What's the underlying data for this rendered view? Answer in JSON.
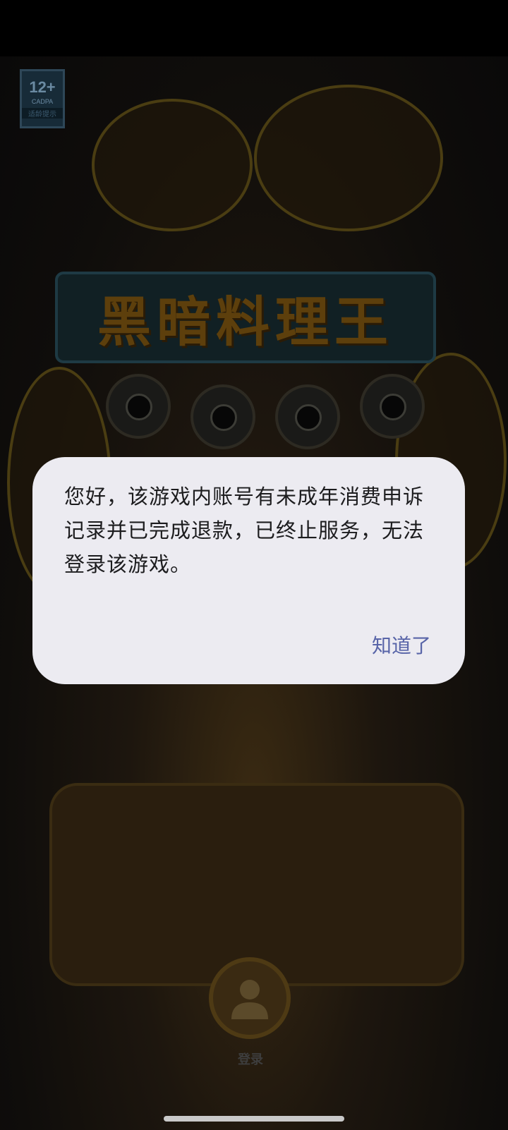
{
  "age_rating": {
    "number": "12+",
    "agency": "CADPA",
    "tip": "适龄提示"
  },
  "game": {
    "title": "黑暗料理王"
  },
  "dialog": {
    "message": "您好，该游戏内账号有未成年消费申诉记录并已完成退款，已终止服务，无法登录该游戏。",
    "confirm_label": "知道了"
  },
  "login": {
    "label": "登录"
  },
  "colors": {
    "dialog_bg": "#ecebf1",
    "accent": "#5864a8"
  }
}
